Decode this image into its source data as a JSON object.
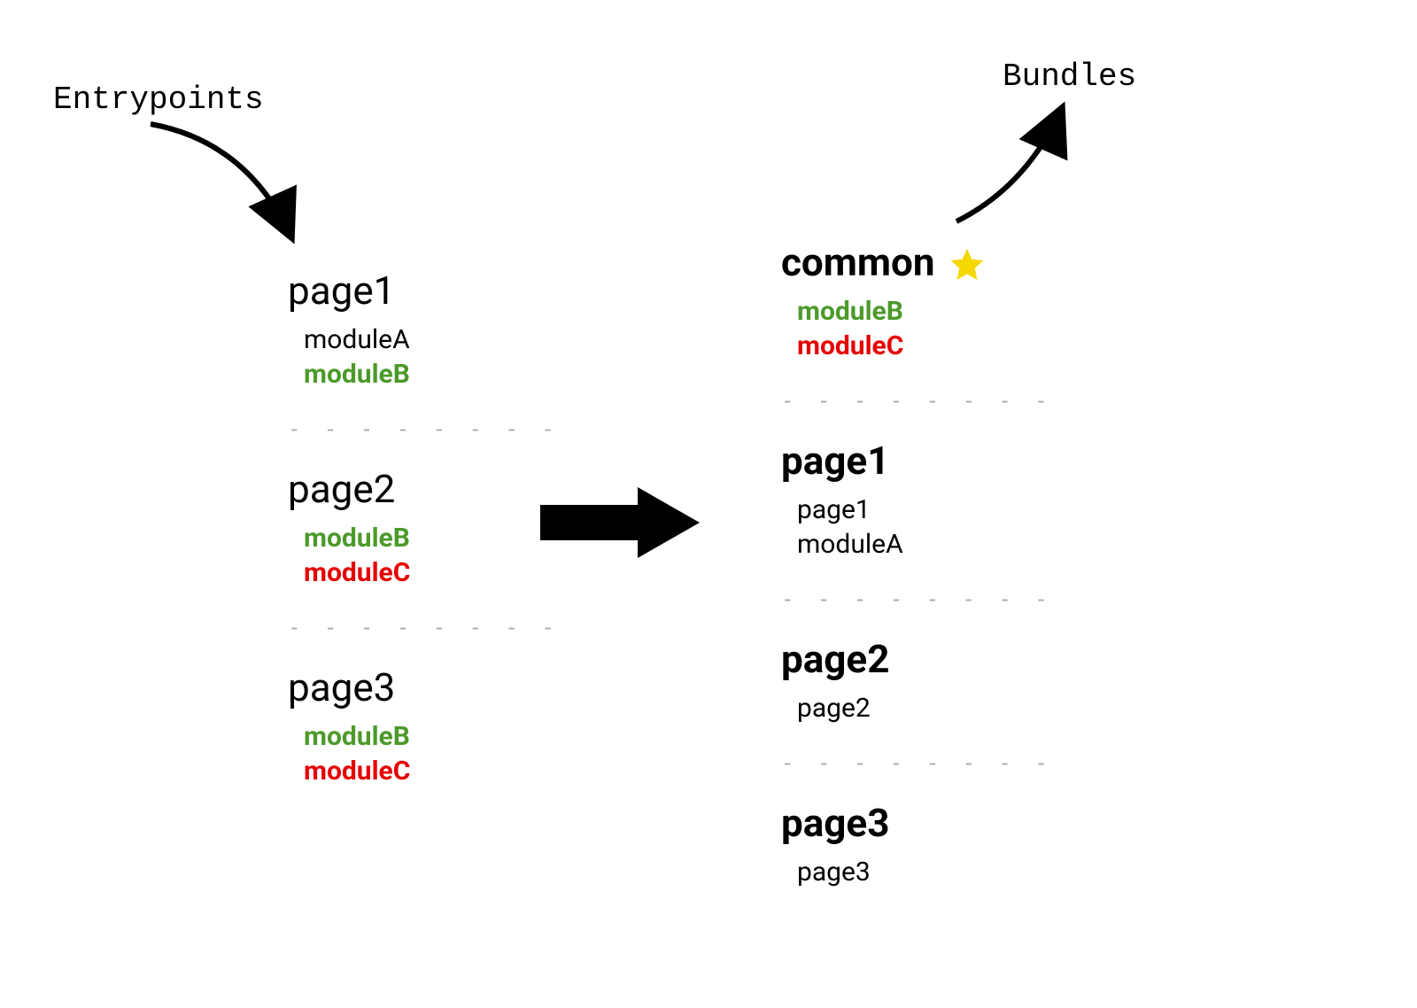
{
  "labels": {
    "entrypoints": "Entrypoints",
    "bundles": "Bundles"
  },
  "left": {
    "groups": [
      {
        "title": "page1",
        "modules": [
          {
            "text": "moduleA",
            "style": "plain"
          },
          {
            "text": "moduleB",
            "style": "bold-green"
          }
        ]
      },
      {
        "title": "page2",
        "modules": [
          {
            "text": "moduleB",
            "style": "bold-green"
          },
          {
            "text": "moduleC",
            "style": "bold-red"
          }
        ]
      },
      {
        "title": "page3",
        "modules": [
          {
            "text": "moduleB",
            "style": "bold-green"
          },
          {
            "text": "moduleC",
            "style": "bold-red"
          }
        ]
      }
    ]
  },
  "right": {
    "groups": [
      {
        "title": "common",
        "starred": true,
        "modules": [
          {
            "text": "moduleB",
            "style": "bold-green"
          },
          {
            "text": "moduleC",
            "style": "bold-red"
          }
        ]
      },
      {
        "title": "page1",
        "modules": [
          {
            "text": "page1",
            "style": "plain"
          },
          {
            "text": "moduleA",
            "style": "plain"
          }
        ]
      },
      {
        "title": "page2",
        "modules": [
          {
            "text": "page2",
            "style": "plain"
          }
        ]
      },
      {
        "title": "page3",
        "modules": [
          {
            "text": "page3",
            "style": "plain"
          }
        ]
      }
    ]
  },
  "divider": "- - - - - - - -",
  "colors": {
    "green": "#4c9a2a",
    "red": "#e60000",
    "star": "#f5d800",
    "divider": "#aaaaaa"
  }
}
